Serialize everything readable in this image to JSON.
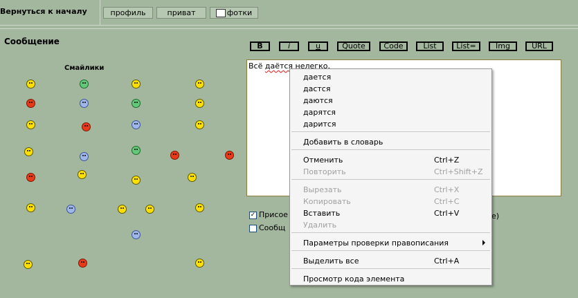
{
  "topbar": {
    "back_link": "Вернуться к началу",
    "profile_label": "профиль",
    "private_label": "приват",
    "photos_label": "фотки"
  },
  "section": {
    "title": "Сообщение",
    "smileys_title": "Смайлики"
  },
  "toolbar": {
    "bold": "B",
    "italic": "i",
    "underline": "u",
    "quote": "Quote",
    "code": "Code",
    "list": "List",
    "list_eq": "List=",
    "img": "Img",
    "url": "URL"
  },
  "editor": {
    "text_prefix": "Всё ",
    "text_misspelled": "даётся",
    "text_suffix": " нелегко."
  },
  "options": {
    "opt1_label": "Присое",
    "opt1_tail": "e)",
    "opt2_label": "Сообщ"
  },
  "context_menu": {
    "suggestions": [
      "дается",
      "дастся",
      "даются",
      "дарятся",
      "дарится"
    ],
    "add_to_dictionary": "Добавить в словарь",
    "undo": {
      "label": "Отменить",
      "shortcut": "Ctrl+Z"
    },
    "redo": {
      "label": "Повторить",
      "shortcut": "Ctrl+Shift+Z"
    },
    "cut": {
      "label": "Вырезать",
      "shortcut": "Ctrl+X"
    },
    "copy": {
      "label": "Копировать",
      "shortcut": "Ctrl+C"
    },
    "paste": {
      "label": "Вставить",
      "shortcut": "Ctrl+V"
    },
    "delete": {
      "label": "Удалить"
    },
    "spellcheck_settings": "Параметры проверки правописания",
    "select_all": {
      "label": "Выделить все",
      "shortcut": "Ctrl+A"
    },
    "inspect": "Просмотр кода элемента"
  },
  "colors": {
    "page_bg": "#a3b69e",
    "menu_bg": "#f5f5f5",
    "disabled_text": "#a0a0a0",
    "editor_border": "#8a7b3f"
  }
}
